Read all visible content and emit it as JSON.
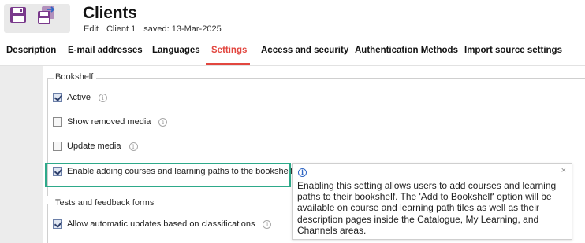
{
  "toolbar": {
    "save_icon": "save-icon",
    "save_as_icon": "save-as-icon"
  },
  "header": {
    "title": "Clients",
    "mode": "Edit",
    "record": "Client 1",
    "saved": "saved: 13-Mar-2025"
  },
  "tabs": [
    {
      "label": "Description"
    },
    {
      "label": "E-mail addresses"
    },
    {
      "label": "Languages"
    },
    {
      "label": "Settings",
      "active": true
    },
    {
      "label": "Access and security"
    },
    {
      "label": "Authentication Methods"
    },
    {
      "label": "Import source settings"
    }
  ],
  "bookshelf": {
    "legend": "Bookshelf",
    "options": [
      {
        "label": "Active",
        "checked": true
      },
      {
        "label": "Show removed media",
        "checked": false
      },
      {
        "label": "Update media",
        "checked": false
      },
      {
        "label": "Enable adding courses and learning paths to the bookshelf",
        "checked": true
      }
    ]
  },
  "tests": {
    "legend": "Tests and feedback forms",
    "options": [
      {
        "label": "Allow automatic updates based on classifications",
        "checked": true
      }
    ]
  },
  "tooltip": {
    "close": "×",
    "text": "Enabling this setting allows users to add courses and learning paths to their bookshelf. The 'Add to Bookshelf' option will be available on course and learning path tiles as well as their description pages inside the Catalogue, My Learning, and Channels areas."
  },
  "colors": {
    "accent": "#e2463f",
    "highlight": "#2ea98a",
    "info": "#2f66c4",
    "save_icon": "#7a3a8c"
  }
}
